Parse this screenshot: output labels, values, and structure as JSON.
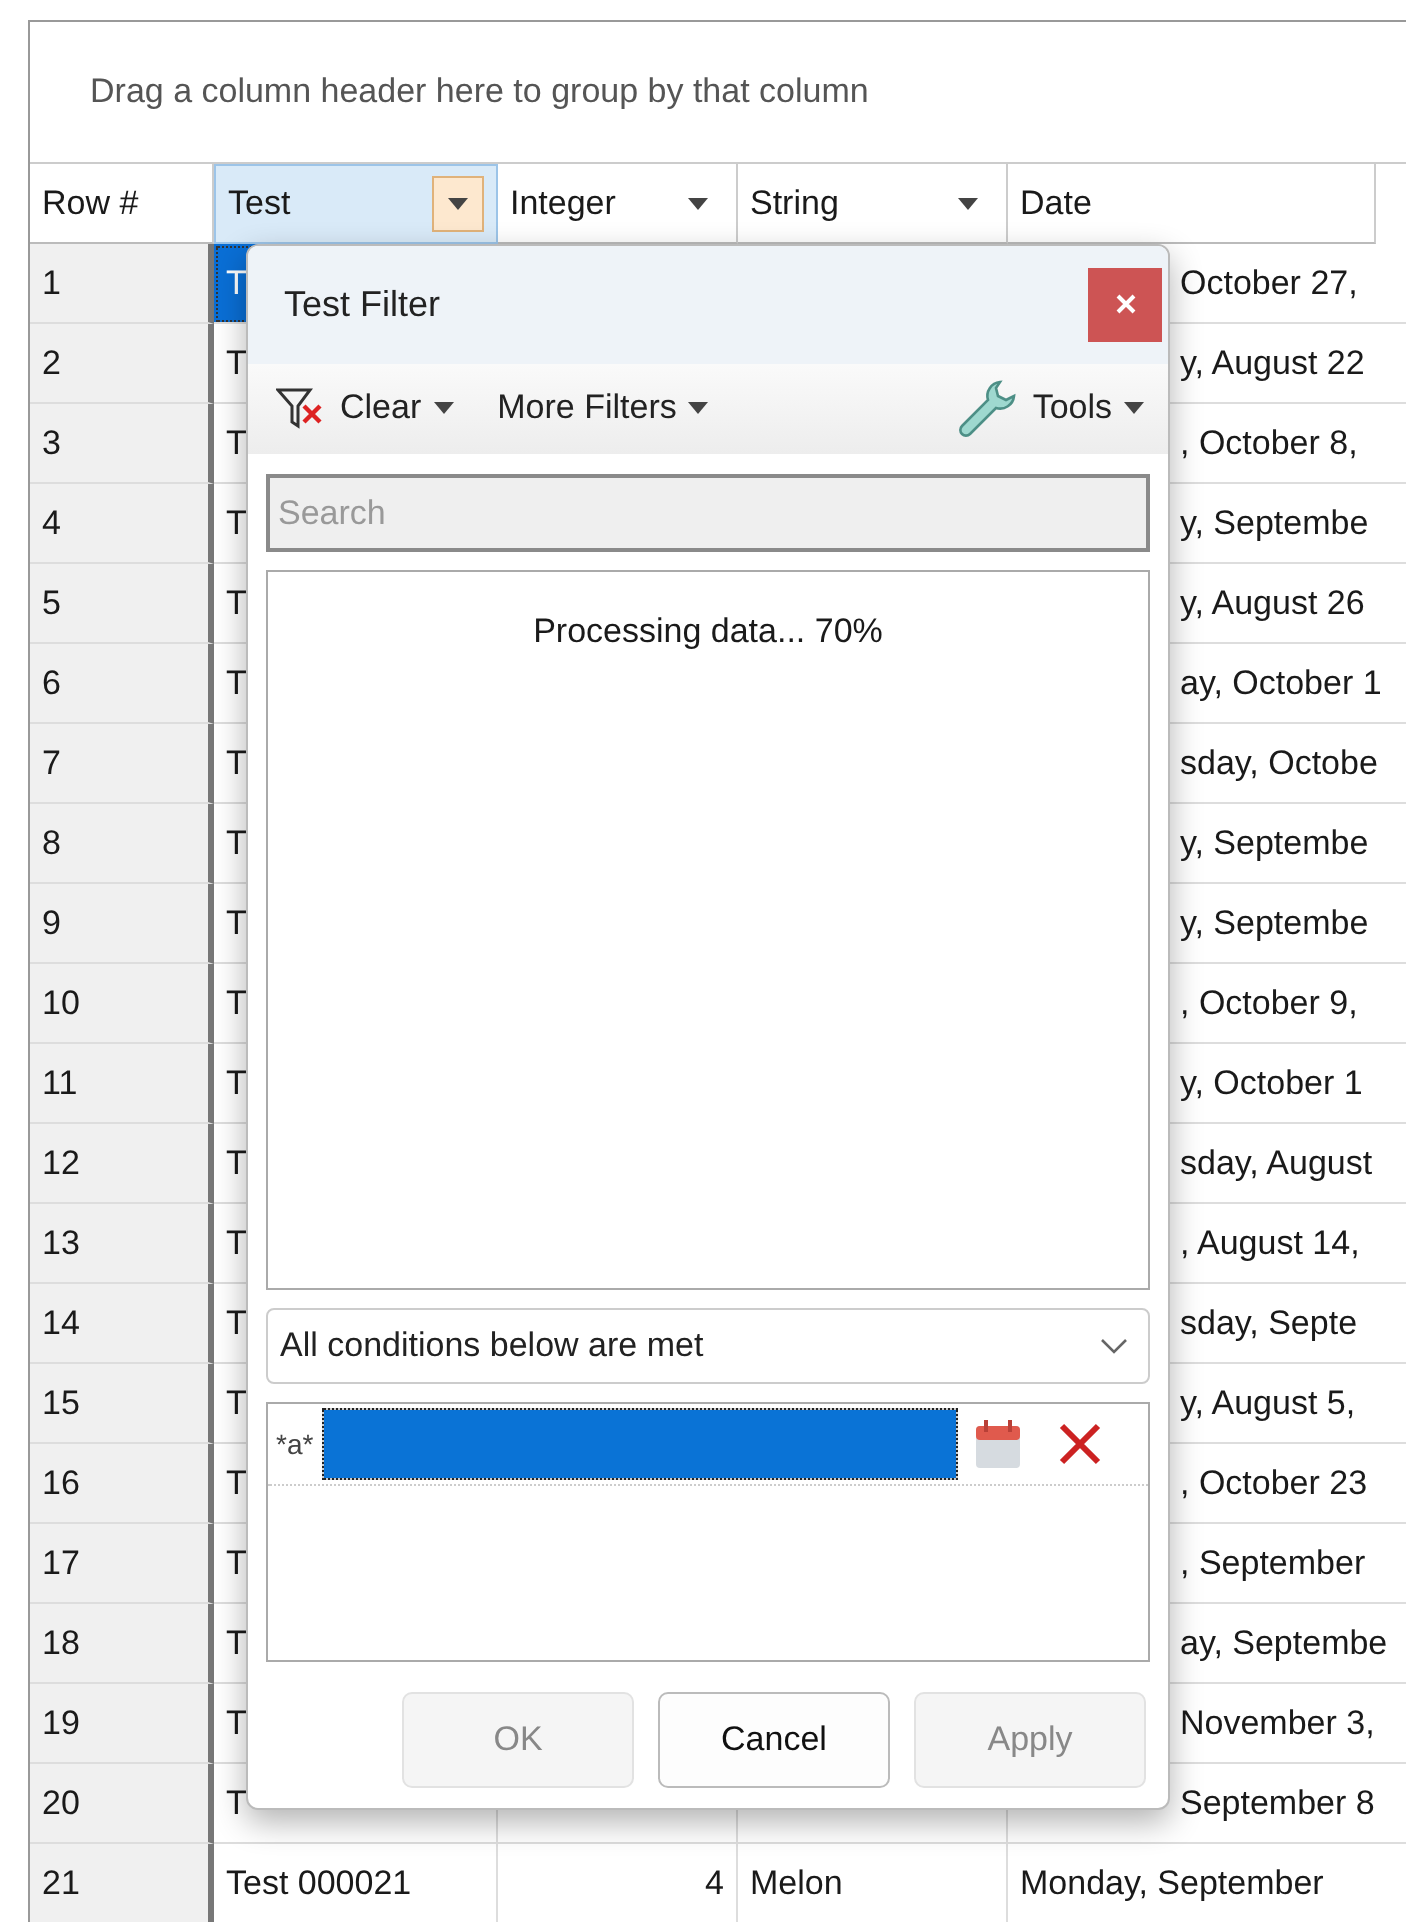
{
  "group_panel": {
    "hint": "Drag a column header here to group by that column"
  },
  "columns": [
    {
      "label": "Row #",
      "selected": false,
      "filter_button": false
    },
    {
      "label": "Test",
      "selected": true,
      "filter_button": true
    },
    {
      "label": "Integer",
      "selected": false,
      "filter_button": true
    },
    {
      "label": "String",
      "selected": false,
      "filter_button": true
    },
    {
      "label": "Date",
      "selected": false,
      "filter_button": false
    }
  ],
  "rows": [
    {
      "kind": "covered",
      "row": "1",
      "test": "T",
      "date": "October 27,",
      "selected": true
    },
    {
      "kind": "covered",
      "row": "2",
      "test": "T",
      "date": "y, August 22",
      "selected": false
    },
    {
      "kind": "covered",
      "row": "3",
      "test": "T",
      "date": ", October 8,",
      "selected": false
    },
    {
      "kind": "covered",
      "row": "4",
      "test": "T",
      "date": "y, Septembe",
      "selected": false
    },
    {
      "kind": "covered",
      "row": "5",
      "test": "T",
      "date": "y, August 26",
      "selected": false
    },
    {
      "kind": "covered",
      "row": "6",
      "test": "T",
      "date": "ay, October 1",
      "selected": false
    },
    {
      "kind": "covered",
      "row": "7",
      "test": "T",
      "date": "sday, Octobe",
      "selected": false
    },
    {
      "kind": "covered",
      "row": "8",
      "test": "T",
      "date": "y, Septembe",
      "selected": false
    },
    {
      "kind": "covered",
      "row": "9",
      "test": "T",
      "date": "y, Septembe",
      "selected": false
    },
    {
      "kind": "covered",
      "row": "10",
      "test": "T",
      "date": ", October 9,",
      "selected": false
    },
    {
      "kind": "covered",
      "row": "11",
      "test": "T",
      "date": "y, October 1",
      "selected": false
    },
    {
      "kind": "covered",
      "row": "12",
      "test": "T",
      "date": "sday, August",
      "selected": false
    },
    {
      "kind": "covered",
      "row": "13",
      "test": "T",
      "date": ", August 14,",
      "selected": false
    },
    {
      "kind": "covered",
      "row": "14",
      "test": "T",
      "date": "sday, Septe",
      "selected": false
    },
    {
      "kind": "covered",
      "row": "15",
      "test": "T",
      "date": "y, August 5,",
      "selected": false
    },
    {
      "kind": "covered",
      "row": "16",
      "test": "T",
      "date": ", October 23",
      "selected": false
    },
    {
      "kind": "covered",
      "row": "17",
      "test": "T",
      "date": ", September",
      "selected": false
    },
    {
      "kind": "covered",
      "row": "18",
      "test": "T",
      "date": "ay, Septembe",
      "selected": false
    },
    {
      "kind": "covered",
      "row": "19",
      "test": "T",
      "date": "November 3,",
      "selected": false
    },
    {
      "kind": "covered",
      "row": "20",
      "test": "T",
      "date": "September 8",
      "selected": false
    },
    {
      "kind": "full",
      "row": "21",
      "test": "Test 000021",
      "integer": "4",
      "string": "Melon",
      "date": "Monday, September",
      "selected": false
    }
  ],
  "filter_popup": {
    "title": "Test Filter",
    "toolbar": [
      {
        "kind": "clear",
        "label": "Clear"
      },
      {
        "kind": "more",
        "label": "More Filters"
      },
      {
        "kind": "tools",
        "label": "Tools"
      }
    ],
    "search": {
      "placeholder": "Search"
    },
    "status": "Processing data... 70%",
    "condition_mode": "All conditions below are met",
    "condition": {
      "operator": "*a*",
      "editor_selected": true
    },
    "buttons": [
      {
        "label": "OK",
        "disabled": true
      },
      {
        "label": "Cancel",
        "disabled": false
      },
      {
        "label": "Apply",
        "disabled": true
      }
    ]
  }
}
